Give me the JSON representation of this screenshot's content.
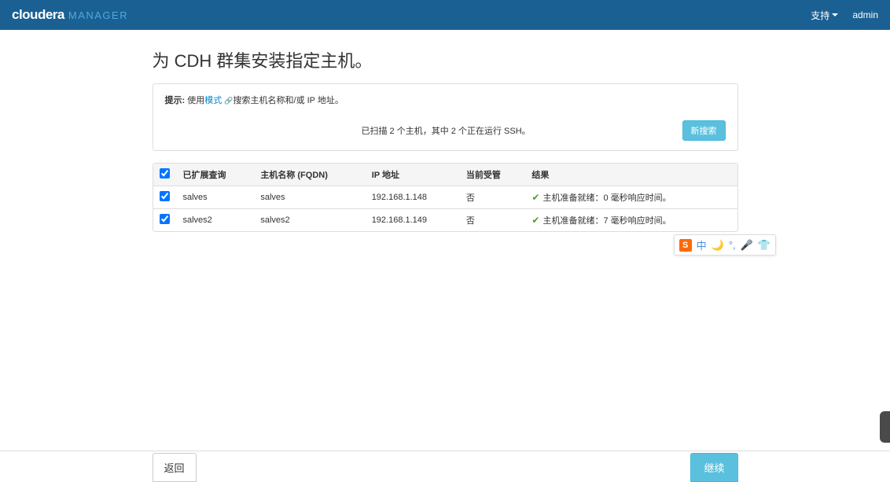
{
  "navbar": {
    "brand_main": "cloudera",
    "brand_sub": "MANAGER",
    "support_label": "支持",
    "admin_label": "admin"
  },
  "page": {
    "title": "为 CDH 群集安装指定主机。"
  },
  "hint": {
    "prefix": "提示: ",
    "text1": "使用",
    "link_text": "模式",
    "text2": "搜索主机名称和/或 IP 地址。"
  },
  "scan": {
    "status": "已扫描 2 个主机，其中 2 个正在运行 SSH。",
    "new_search_btn": "新搜索"
  },
  "table": {
    "headers": {
      "expanded": "已扩展查询",
      "hostname": "主机名称 (FQDN)",
      "ip": "IP 地址",
      "managed": "当前受管",
      "result": "结果"
    },
    "rows": [
      {
        "expanded": "salves",
        "hostname": "salves",
        "ip": "192.168.1.148",
        "managed": "否",
        "result": "主机准备就绪：0 毫秒响应时间。"
      },
      {
        "expanded": "salves2",
        "hostname": "salves2",
        "ip": "192.168.1.149",
        "managed": "否",
        "result": "主机准备就绪：7 毫秒响应时间。"
      }
    ]
  },
  "ime": {
    "s": "S",
    "zhong": "中"
  },
  "footer": {
    "back": "返回",
    "continue": "继续"
  }
}
